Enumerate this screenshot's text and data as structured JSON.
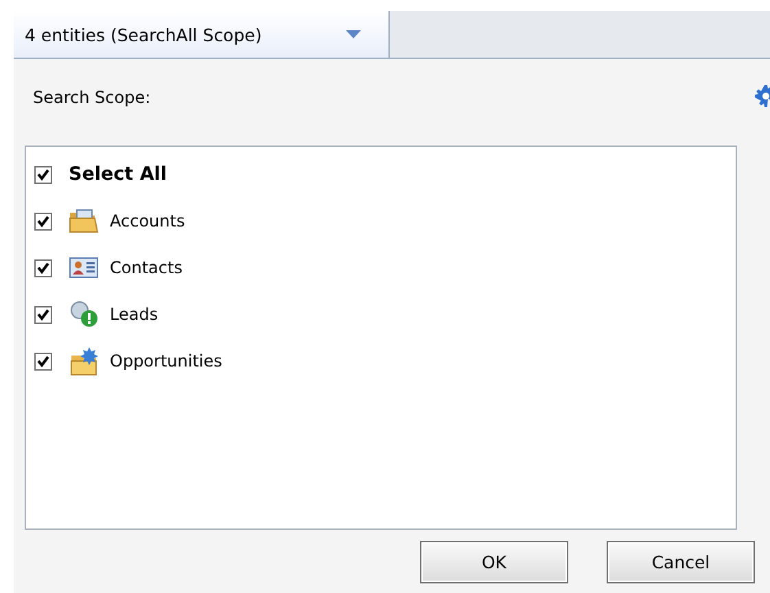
{
  "scope_dropdown": {
    "label": "4 entities (SearchAll Scope)"
  },
  "panel": {
    "title": "Search Scope:"
  },
  "items": [
    {
      "label": "Select All",
      "kind": "all",
      "checked": true
    },
    {
      "label": "Accounts",
      "kind": "folder",
      "checked": true
    },
    {
      "label": "Contacts",
      "kind": "card",
      "checked": true
    },
    {
      "label": "Leads",
      "kind": "lead",
      "checked": true
    },
    {
      "label": "Opportunities",
      "kind": "opportunity",
      "checked": true
    }
  ],
  "buttons": [
    "OK",
    "Cancel"
  ]
}
